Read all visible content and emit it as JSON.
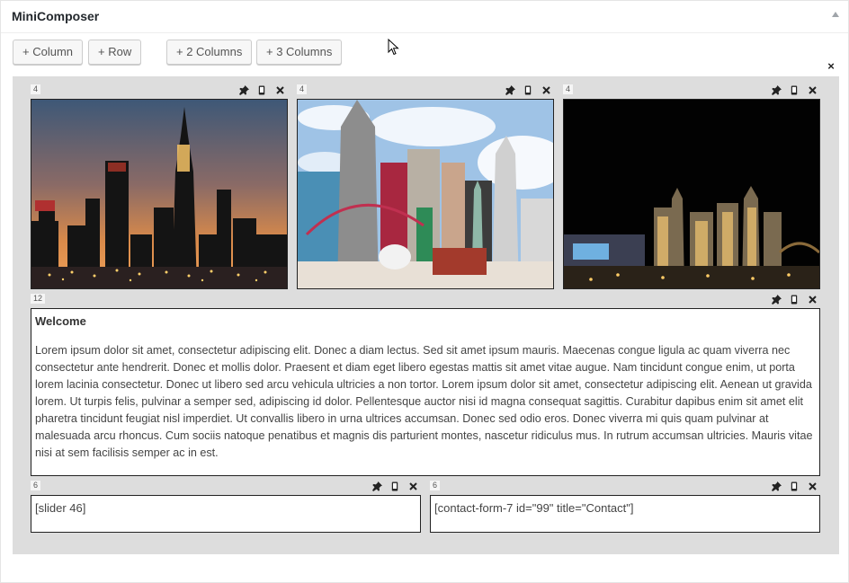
{
  "panel": {
    "title": "MiniComposer"
  },
  "toolbar": {
    "add_column": "+ Column",
    "add_row": "+ Row",
    "add_2_columns": "+ 2 Columns",
    "add_3_columns": "+ 3 Columns"
  },
  "row": {
    "close_symbol": "×"
  },
  "columns": [
    {
      "width": "4",
      "content_type": "image"
    },
    {
      "width": "4",
      "content_type": "image"
    },
    {
      "width": "4",
      "content_type": "image"
    },
    {
      "width": "12",
      "content_type": "text",
      "title": "Welcome",
      "body": "Lorem ipsum dolor sit amet, consectetur adipiscing elit. Donec a diam lectus. Sed sit amet ipsum mauris. Maecenas congue ligula ac quam viverra nec consectetur ante hendrerit. Donec et mollis dolor. Praesent et diam eget libero egestas mattis sit amet vitae augue. Nam tincidunt congue enim, ut porta lorem lacinia consectetur. Donec ut libero sed arcu vehicula ultricies a non tortor. Lorem ipsum dolor sit amet, consectetur adipiscing elit. Aenean ut gravida lorem. Ut turpis felis, pulvinar a semper sed, adipiscing id dolor. Pellentesque auctor nisi id magna consequat sagittis. Curabitur dapibus enim sit amet elit pharetra tincidunt feugiat nisl imperdiet. Ut convallis libero in urna ultrices accumsan. Donec sed odio eros. Donec viverra mi quis quam pulvinar at malesuada arcu rhoncus. Cum sociis natoque penatibus et magnis dis parturient montes, nascetur ridiculus mus. In rutrum accumsan ultricies. Mauris vitae nisi at sem facilisis semper ac in est."
    },
    {
      "width": "6",
      "content_type": "shortcode",
      "text": "[slider 46]"
    },
    {
      "width": "6",
      "content_type": "shortcode",
      "text": "[contact-form-7 id=\"99\" title=\"Contact\"]"
    }
  ],
  "icons": {
    "column_tools": [
      "pin-icon",
      "mobile-icon",
      "close-icon"
    ],
    "collapse": "triangle-up-icon",
    "cursor": "mouse-pointer-icon"
  }
}
